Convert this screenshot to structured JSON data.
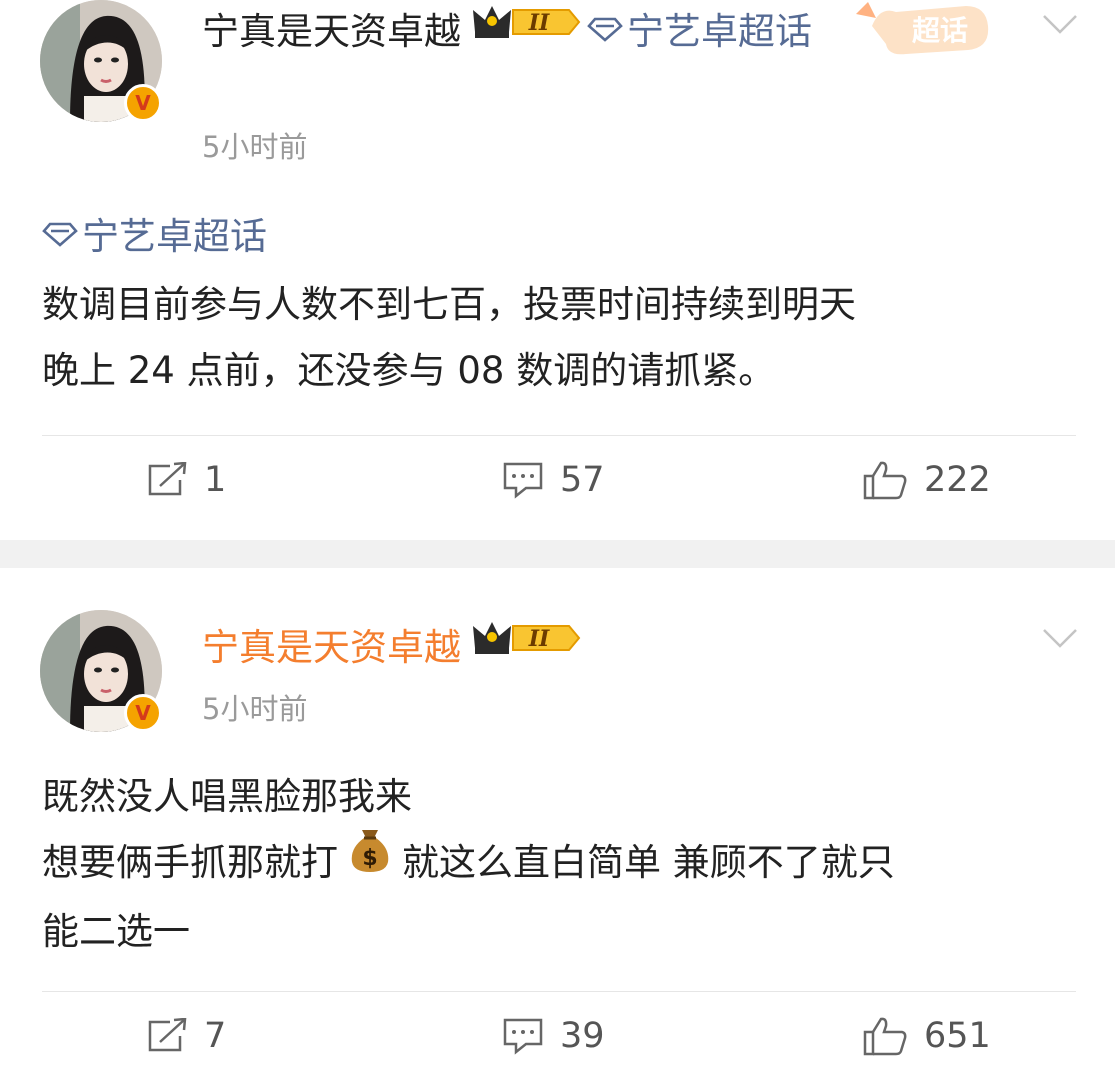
{
  "posts": [
    {
      "author": "宁真是天资卓越",
      "level_badge": "II",
      "topic_inline": "宁艺卓超话",
      "time": "5小时前",
      "supertopic_label": "超话",
      "topic_tag": "宁艺卓超话",
      "lines": [
        "数调目前参与人数不到七百，投票时间持续到明天",
        "晚上 24 点前，还没参与 08 数调的请抓紧。"
      ],
      "reposts": "1",
      "comments": "57",
      "likes": "222"
    },
    {
      "author": "宁真是天资卓越",
      "level_badge": "II",
      "time": "5小时前",
      "lines": [
        "既然没人唱黑脸那我来",
        "想要俩手抓那就打",
        "就这么直白简单 兼顾不了就只",
        "能二选一"
      ],
      "emoji": "money-bag",
      "reposts": "7",
      "comments": "39",
      "likes": "651"
    }
  ],
  "colors": {
    "topic_blue": "#566b94",
    "name_orange": "#f47e2e",
    "time_gray": "#9a9a9a",
    "separator": "#f1f1f1",
    "verified_gold": "#f5a300"
  }
}
